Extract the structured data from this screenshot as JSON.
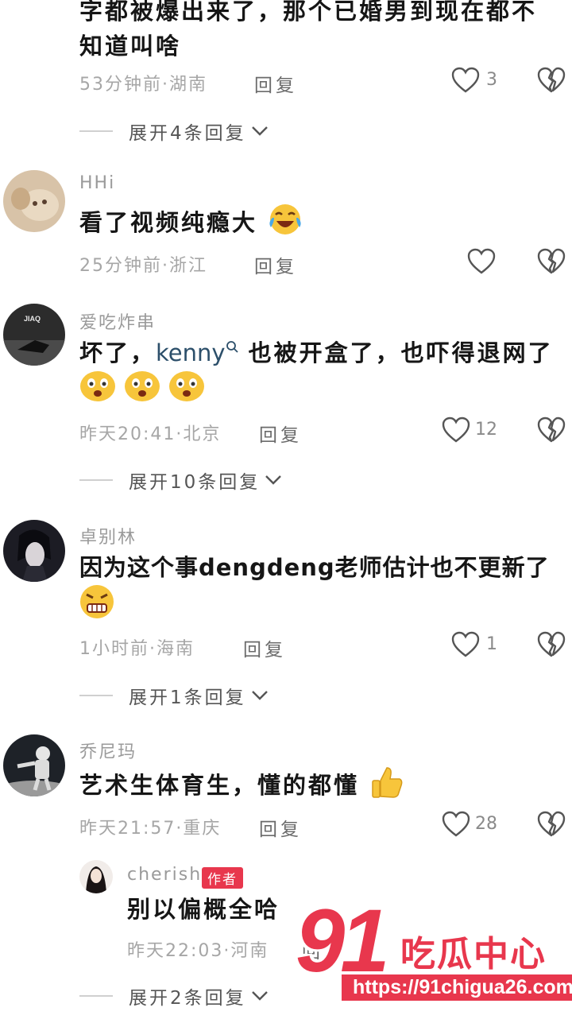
{
  "colors": {
    "accent": "#e8374d",
    "text": "#161616",
    "meta": "#a6a6a6",
    "mention": "#2c4f6a"
  },
  "top_comment": {
    "text_line1": "字都被爆出来了，那个已婚男到现在都不",
    "text_line2": "知道叫啥",
    "meta": "53分钟前·湖南",
    "reply_label": "回复",
    "likes": "3",
    "expand_label": "展开4条回复"
  },
  "comments": [
    {
      "username": "HHi",
      "text": "看了视频纯瘾大",
      "emoji": "laugh-cry-emoji",
      "meta": "25分钟前·浙江",
      "reply_label": "回复",
      "likes": ""
    },
    {
      "username": "爱吃炸串",
      "avatar_label": "JIAQ",
      "text_before": "坏了，",
      "mention": "kenny",
      "text_after": "也被开盒了，也吓得退网了",
      "emoji": "scared-emoji",
      "meta": "昨天20:41·北京",
      "reply_label": "回复",
      "likes": "12",
      "expand_label": "展开10条回复"
    },
    {
      "username": "卓别林",
      "text": "因为这个事dengdeng老师估计也不更新了",
      "emoji": "grimace-emoji",
      "meta": "1小时前·海南",
      "reply_label": "回复",
      "likes": "1",
      "expand_label": "展开1条回复"
    },
    {
      "username": "乔尼玛",
      "text": "艺术生体育生，懂的都懂",
      "emoji": "thumbs-up-emoji",
      "meta": "昨天21:57·重庆",
      "reply_label": "回复",
      "likes": "28"
    }
  ],
  "sub_reply": {
    "username": "cherish",
    "tag": "作者",
    "text": "别以偏概全哈",
    "meta": "昨天22:03·河南",
    "reply_label": "回复",
    "expand_label": "展开2条回复"
  },
  "watermark": {
    "number": "91",
    "name": "吃瓜中心",
    "url": "https://91chigua26.com"
  }
}
